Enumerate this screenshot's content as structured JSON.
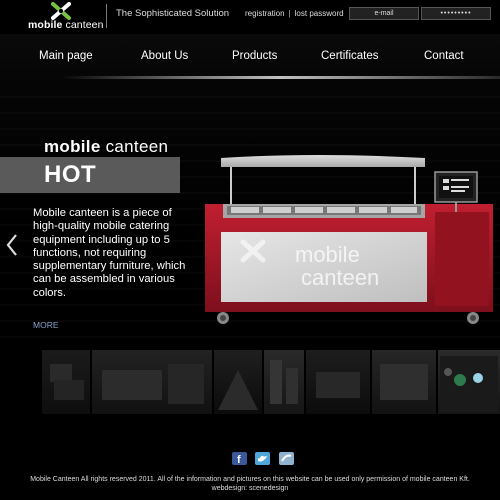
{
  "brand": {
    "logo_bold": "mobile",
    "logo_light": " canteen",
    "tagline": "The Sophisticated Solution"
  },
  "account": {
    "registration": "registration",
    "separator": "|",
    "lost_password": "lost password",
    "email_placeholder": "e-mail",
    "password_masked": "•••••••••"
  },
  "nav": {
    "items": [
      {
        "label": "Main page"
      },
      {
        "label": "About Us"
      },
      {
        "label": "Products"
      },
      {
        "label": "Certificates"
      },
      {
        "label": "Contact"
      }
    ]
  },
  "hero": {
    "title_bold": "mobile",
    "title_light": " canteen",
    "badge": "HOT",
    "description": "Mobile canteen is a piece of high-quality mobile catering equipment including up to 5 functions, not requiring supplementary furniture, which can be assembled in various colors.",
    "more": "MORE",
    "panel_logo_line1": "mobile",
    "panel_logo_line2": "canteen"
  },
  "footer": {
    "social_icons": [
      "facebook-icon",
      "twitter-icon",
      "share-icon"
    ],
    "line1": "Mobile Canteen All rights reserved 2011. All of the information and pictures on this website can be used only permission of mobile canteen Kft.",
    "line2": "webdesign: scenedesign"
  },
  "colors": {
    "accent_red": "#a8182a",
    "logo_green": "#7cc242",
    "link_blue": "#8aa2c8",
    "facebook": "#3b5998",
    "twitter": "#4fa6d9"
  }
}
